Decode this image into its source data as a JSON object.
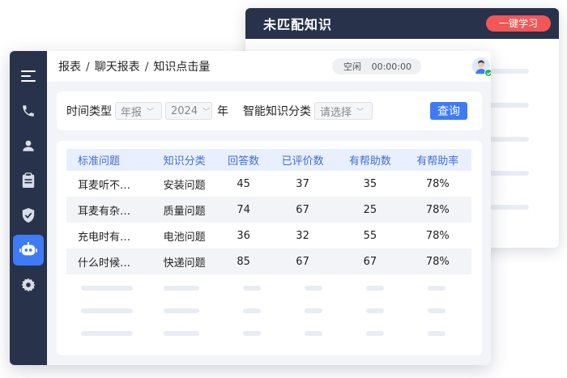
{
  "back_window": {
    "title": "未匹配知识",
    "learn_button": "一键学习"
  },
  "breadcrumb": [
    "报表",
    "聊天报表",
    "知识点击量"
  ],
  "breadcrumb_sep": "/",
  "status": {
    "state": "空闲",
    "timer": "00:00:00"
  },
  "filters": {
    "time_type_label": "时间类型",
    "time_type_value": "年报",
    "year_value": "2024",
    "year_suffix": "年",
    "category_label": "智能知识分类",
    "category_placeholder": "请选择",
    "query_button": "查询"
  },
  "table": {
    "headers": [
      "标准问题",
      "知识分类",
      "回答数",
      "已评价数",
      "有帮助数",
      "有帮助率"
    ],
    "rows": [
      [
        "耳麦听不…",
        "安装问题",
        "45",
        "37",
        "35",
        "78%"
      ],
      [
        "耳麦有杂…",
        "质量问题",
        "74",
        "67",
        "25",
        "78%"
      ],
      [
        "充电时有…",
        "电池问题",
        "36",
        "32",
        "55",
        "78%"
      ],
      [
        "什么时候…",
        "快递问题",
        "85",
        "67",
        "67",
        "78%"
      ]
    ]
  },
  "colors": {
    "sidebar": "#28324a",
    "accent": "#3e7bf5",
    "danger": "#f25656"
  },
  "sidebar_icons": [
    "menu-icon",
    "phone-icon",
    "user-icon",
    "clipboard-icon",
    "shield-icon",
    "robot-icon",
    "gear-icon"
  ]
}
